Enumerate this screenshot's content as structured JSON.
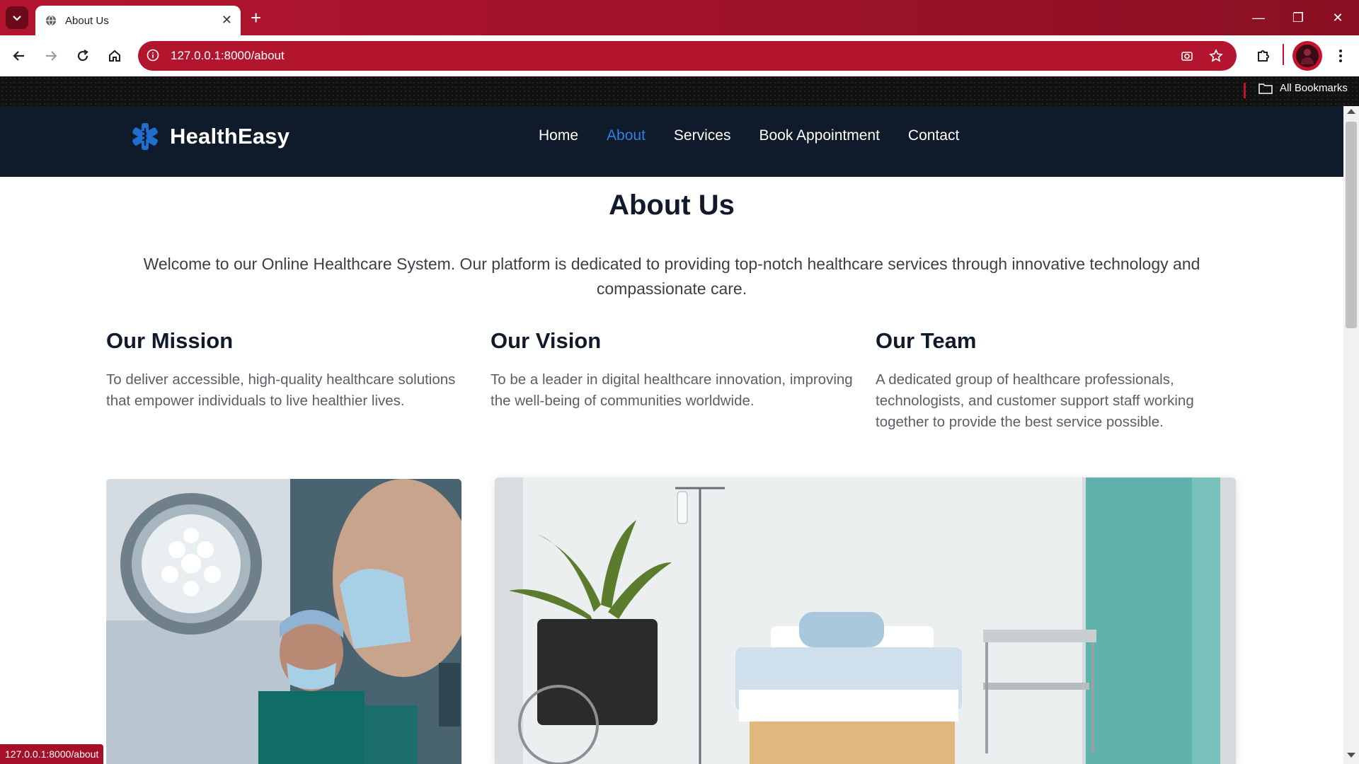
{
  "browser": {
    "tab_title": "About Us",
    "url": "127.0.0.1:8000/about",
    "bookmarks_label": "All Bookmarks",
    "status_url": "127.0.0.1:8000/about",
    "accent": "#b3152f"
  },
  "site": {
    "brand": "HealthEasy",
    "nav": [
      "Home",
      "About",
      "Services",
      "Book Appointment",
      "Contact"
    ],
    "active_nav": "About",
    "nav_active_color": "#2f7fe6",
    "header_bg": "#0f1a2a"
  },
  "about": {
    "title": "About Us",
    "intro": "Welcome to our Online Healthcare System. Our platform is dedicated to providing top-notch healthcare services through innovative technology and compassionate care.",
    "sections": [
      {
        "heading": "Our Mission",
        "text": "To deliver accessible, high-quality healthcare solutions that empower individuals to live healthier lives."
      },
      {
        "heading": "Our Vision",
        "text": "To be a leader in digital healthcare innovation, improving the well-being of communities worldwide."
      },
      {
        "heading": "Our Team",
        "text": "A dedicated group of healthcare professionals, technologists, and customer support staff working together to provide the best service possible."
      }
    ]
  }
}
